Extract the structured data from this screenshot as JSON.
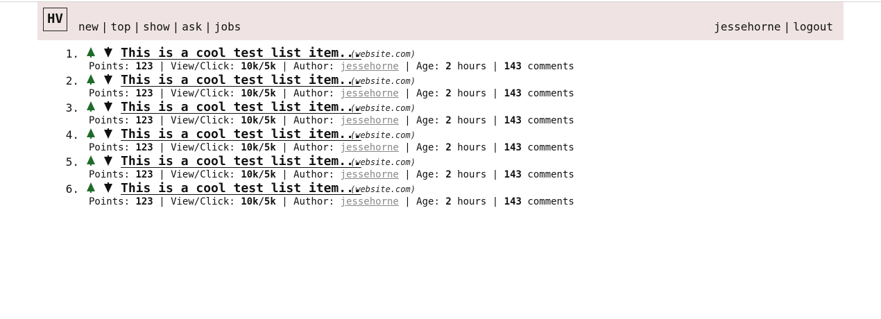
{
  "header": {
    "logo": "HV",
    "nav": [
      "new",
      "top",
      "show",
      "ask",
      "jobs"
    ],
    "user": "jessehorne",
    "logout": "logout",
    "separator": "|"
  },
  "colors": {
    "header_bg": "#efe3e3",
    "upvote": "#1f6b2a",
    "downvote": "#111111",
    "author_link": "#888888"
  },
  "labels": {
    "points": "Points:",
    "viewclick": "View/Click:",
    "author": "Author:",
    "age": "Age:",
    "hours": "hours",
    "comments": "comments",
    "sep": "|"
  },
  "items": [
    {
      "rank": "1.",
      "title": "This is a cool test list item...",
      "site": "(website.com)",
      "points": "123",
      "viewclick": "10k/5k",
      "author": "jessehorne",
      "age": "2",
      "comments": "143"
    },
    {
      "rank": "2.",
      "title": "This is a cool test list item...",
      "site": "(website.com)",
      "points": "123",
      "viewclick": "10k/5k",
      "author": "jessehorne",
      "age": "2",
      "comments": "143"
    },
    {
      "rank": "3.",
      "title": "This is a cool test list item...",
      "site": "(website.com)",
      "points": "123",
      "viewclick": "10k/5k",
      "author": "jessehorne",
      "age": "2",
      "comments": "143"
    },
    {
      "rank": "4.",
      "title": "This is a cool test list item...",
      "site": "(website.com)",
      "points": "123",
      "viewclick": "10k/5k",
      "author": "jessehorne",
      "age": "2",
      "comments": "143"
    },
    {
      "rank": "5.",
      "title": "This is a cool test list item...",
      "site": "(website.com)",
      "points": "123",
      "viewclick": "10k/5k",
      "author": "jessehorne",
      "age": "2",
      "comments": "143"
    },
    {
      "rank": "6.",
      "title": "This is a cool test list item...",
      "site": "(website.com)",
      "points": "123",
      "viewclick": "10k/5k",
      "author": "jessehorne",
      "age": "2",
      "comments": "143"
    }
  ]
}
